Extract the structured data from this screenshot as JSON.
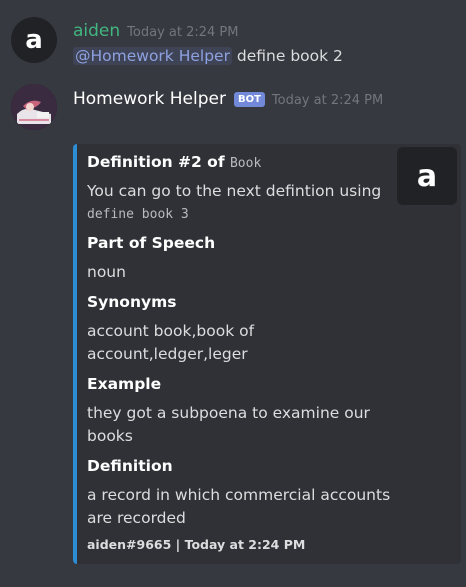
{
  "message1": {
    "avatar_letter": "a",
    "username": "aiden",
    "username_color": "#43b581",
    "timestamp": "Today at 2:24 PM",
    "mention": "@Homework Helper",
    "text": "define book 2"
  },
  "message2": {
    "avatar_icon": "anime-girl-avatar",
    "username": "Homework Helper",
    "bot_tag": "BOT",
    "timestamp": "Today at 2:24 PM"
  },
  "embed": {
    "color": "#2d8dd4",
    "title_prefix": "Definition #2 of",
    "title_word": "Book",
    "thumbnail_letter": "a",
    "desc_line1": "You can go to the next defintion using",
    "desc_code": "define book 3",
    "fields": [
      {
        "name": "Part of Speech",
        "value": "noun"
      },
      {
        "name": "Synonyms",
        "value_line1": "account book,book of",
        "value_line2": "account,ledger,leger"
      },
      {
        "name": "Example",
        "value_line1": "they got a subpoena to examine our",
        "value_line2": "books"
      },
      {
        "name": "Definition",
        "value_line1": "a record in which commercial accounts",
        "value_line2": "are recorded"
      }
    ],
    "footer": "aiden#9665 | Today at 2:24 PM"
  }
}
